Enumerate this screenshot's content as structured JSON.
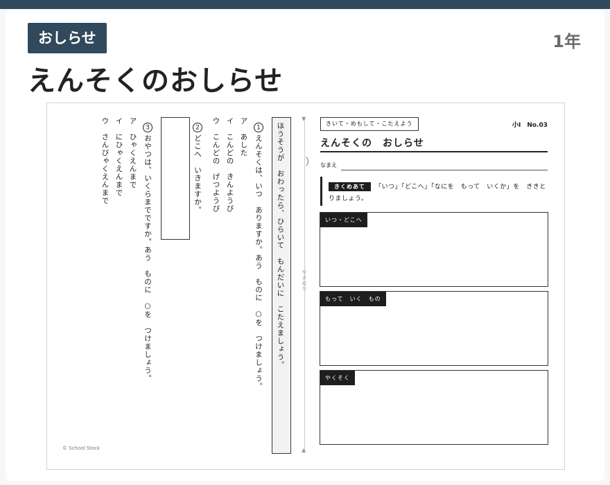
{
  "header": {
    "tag": "おしらせ",
    "grade": "1年",
    "title": "えんそくのおしらせ"
  },
  "left_page": {
    "instruction": "ほうそうが　おわったら、ひらいて　もんだいに　こたえましょう。",
    "q1": {
      "number": "1",
      "text": "えんそくは、いつ　ありますか。あう　ものに　○を　つけましょう。",
      "options": [
        "ア　あした",
        "イ　こんどの　きんようび",
        "ウ　こんどの　げつようび"
      ]
    },
    "q2": {
      "number": "2",
      "text": "どこへ　いきますか。"
    },
    "q3": {
      "number": "3",
      "text": "おやつは、いくらまでですか。あう　ものに　○を　つけましょう。",
      "options": [
        "ア　ひゃくえんまで",
        "イ　にひゃくえんまで",
        "ウ　さんびゃくえんまで"
      ]
    },
    "copyright": "© School Stock"
  },
  "fold": {
    "label": "やまおり"
  },
  "right_page": {
    "subtitle": "きいて・めもして・こたえよう",
    "issue": "小Ⅰ　No.03",
    "title": "えんそくの　おしらせ",
    "name_label": "なまえ",
    "goal_badge": "きくめあて",
    "goal_text_line1": "「いつ」「どこへ」「なにを　もって　いくか」を　ききと",
    "goal_text_line2": "りましょう。",
    "boxes": [
      {
        "label": "いつ・どこへ"
      },
      {
        "label": "もって　いく　もの"
      },
      {
        "label": "やくそく"
      }
    ]
  }
}
